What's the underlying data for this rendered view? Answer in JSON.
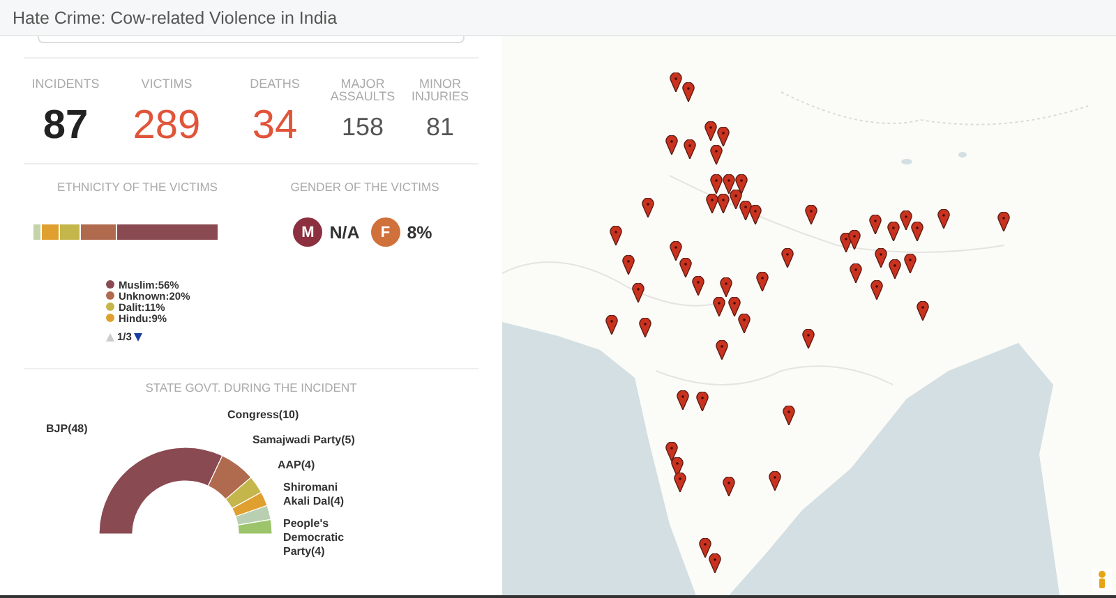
{
  "header": {
    "title": "Hate Crime: Cow-related Violence in India"
  },
  "stats": [
    {
      "label": "INCIDENTS",
      "value": "87",
      "kind": "primary"
    },
    {
      "label": "VICTIMS",
      "value": "289",
      "kind": "alert"
    },
    {
      "label": "DEATHS",
      "value": "34",
      "kind": "alert"
    },
    {
      "label": "MAJOR ASSAULTS",
      "value": "158",
      "kind": "minor"
    },
    {
      "label": "MINOR INJURIES",
      "value": "81",
      "kind": "minor"
    }
  ],
  "ethnicity": {
    "title": "ETHNICITY OF THE VICTIMS",
    "segments": [
      {
        "color": "#c5d3a8"
      },
      {
        "color": "#e0a030"
      },
      {
        "color": "#c4b64a"
      },
      {
        "color": "#b06a4e"
      },
      {
        "color": "#8a4a52"
      }
    ],
    "legend": [
      {
        "label": "Muslim:56%",
        "color": "#8a4a52"
      },
      {
        "label": "Unknown:20%",
        "color": "#b06a4e"
      },
      {
        "label": "Dalit:11%",
        "color": "#c4b64a"
      },
      {
        "label": "Hindu:9%",
        "color": "#e0a030"
      }
    ],
    "pager": {
      "text": "1/3",
      "prev_disabled": true,
      "next_disabled": false
    }
  },
  "gender": {
    "title": "GENDER OF THE VICTIMS",
    "items": [
      {
        "symbol": "M",
        "value": "N/A",
        "color": "#8c2f3f"
      },
      {
        "symbol": "F",
        "value": "8%",
        "color": "#d0703a"
      }
    ]
  },
  "state_govt": {
    "title": "STATE GOVT. DURING THE INCIDENT",
    "chart_data": {
      "type": "donut",
      "categories": [
        "BJP(48)",
        "Congress(10)",
        "Samajwadi Party(5)",
        "AAP(4)",
        "Shiromani Akali Dal(4)",
        "People's Democratic Party(4)"
      ],
      "series": [
        {
          "values": [
            48,
            10,
            5,
            4,
            4,
            4
          ]
        }
      ],
      "colors": [
        "#8a4a52",
        "#b06a4e",
        "#c4b64a",
        "#e0a030",
        "#b9cfb2",
        "#9cc46a"
      ]
    }
  }
}
